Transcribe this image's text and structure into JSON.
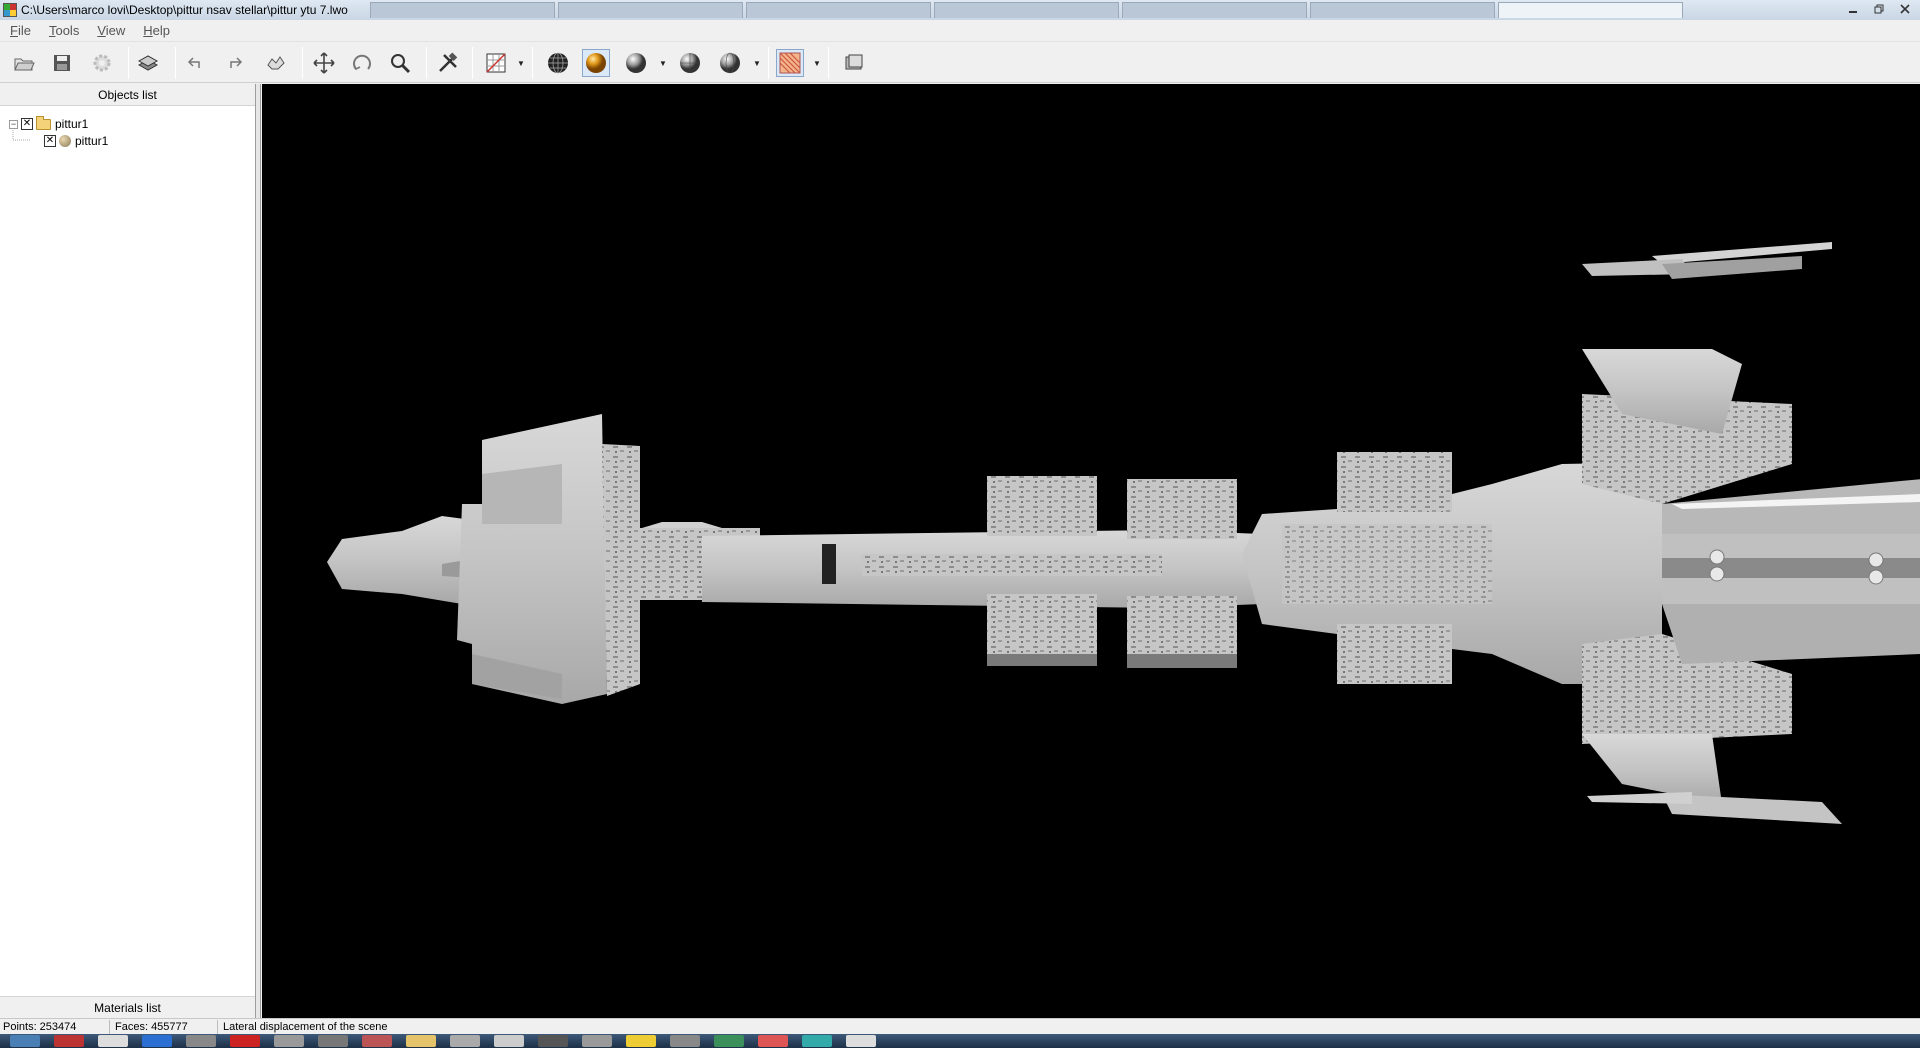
{
  "window": {
    "title": "C:\\Users\\marco lovi\\Desktop\\pittur nsav stellar\\pittur ytu 7.lwo",
    "controls": [
      "minimize",
      "restore",
      "close"
    ]
  },
  "menu": {
    "file": "File",
    "tools": "Tools",
    "view": "View",
    "help": "Help"
  },
  "toolbar": {
    "buttons": [
      {
        "name": "open-icon"
      },
      {
        "name": "save-icon"
      },
      {
        "name": "settings-gear-icon"
      },
      {
        "name": "layers-icon"
      },
      {
        "name": "undo-icon"
      },
      {
        "name": "redo-icon"
      },
      {
        "name": "hand-icon"
      },
      {
        "name": "move-icon"
      },
      {
        "name": "rotate-icon"
      },
      {
        "name": "zoom-icon"
      },
      {
        "name": "tools-icon"
      },
      {
        "name": "grid-icon"
      },
      {
        "name": "wireframe-sphere-icon"
      },
      {
        "name": "textured-sphere-icon"
      },
      {
        "name": "shaded-sphere-icon"
      },
      {
        "name": "flat-sphere-icon"
      },
      {
        "name": "smooth-sphere-icon"
      },
      {
        "name": "texture-map-icon"
      },
      {
        "name": "screenshot-icon"
      }
    ]
  },
  "objects_panel": {
    "header": "Objects list",
    "tree": [
      {
        "label": "pittur1",
        "type": "group",
        "checked": true,
        "expanded": true
      },
      {
        "label": "pittur1",
        "type": "object",
        "checked": true
      }
    ],
    "materials_header": "Materials list"
  },
  "status": {
    "points": "Points: 253474",
    "faces": "Faces: 455777",
    "hint": "Lateral displacement of the scene"
  },
  "colors": {
    "viewport_bg": "#000000",
    "model_fill": "#c8c8c8",
    "model_shadow": "#8a8a8a"
  }
}
